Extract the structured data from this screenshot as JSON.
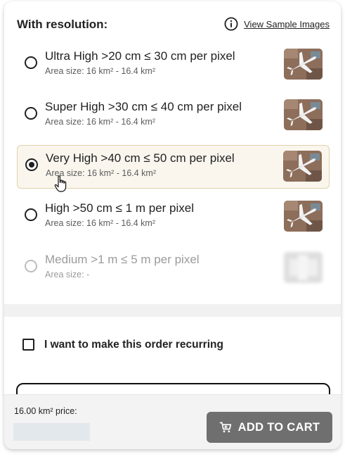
{
  "section": {
    "title": "With resolution:",
    "info_icon": "info-circle-icon",
    "sample_link": "View Sample Images"
  },
  "options": [
    {
      "label": "Ultra High >20 cm ≤ 30 cm per pixel",
      "area": "Area size: 16 km² - 16.4 km²",
      "selected": false,
      "disabled": false
    },
    {
      "label": "Super High >30 cm ≤ 40 cm per pixel",
      "area": "Area size: 16 km² - 16.4 km²",
      "selected": false,
      "disabled": false
    },
    {
      "label": "Very High >40 cm ≤ 50 cm per pixel",
      "area": "Area size: 16 km² - 16.4 km²",
      "selected": true,
      "disabled": false
    },
    {
      "label": "High >50 cm ≤ 1 m per pixel",
      "area": "Area size: 16 km² - 16.4 km²",
      "selected": false,
      "disabled": false
    },
    {
      "label": "Medium >1 m ≤ 5 m per pixel",
      "area": "Area size: -",
      "selected": false,
      "disabled": true
    }
  ],
  "recurring": {
    "label": "I want to make this order recurring",
    "checked": false
  },
  "footer": {
    "price_label": "16.00 km² price:",
    "cart_icon": "cart-icon",
    "add_to_cart": "ADD TO CART"
  },
  "colors": {
    "selected_bg": "#faf6ee",
    "selected_border": "#e1d2a9",
    "button_bg": "#6f6f6f",
    "price_placeholder": "#e3e8ec"
  }
}
